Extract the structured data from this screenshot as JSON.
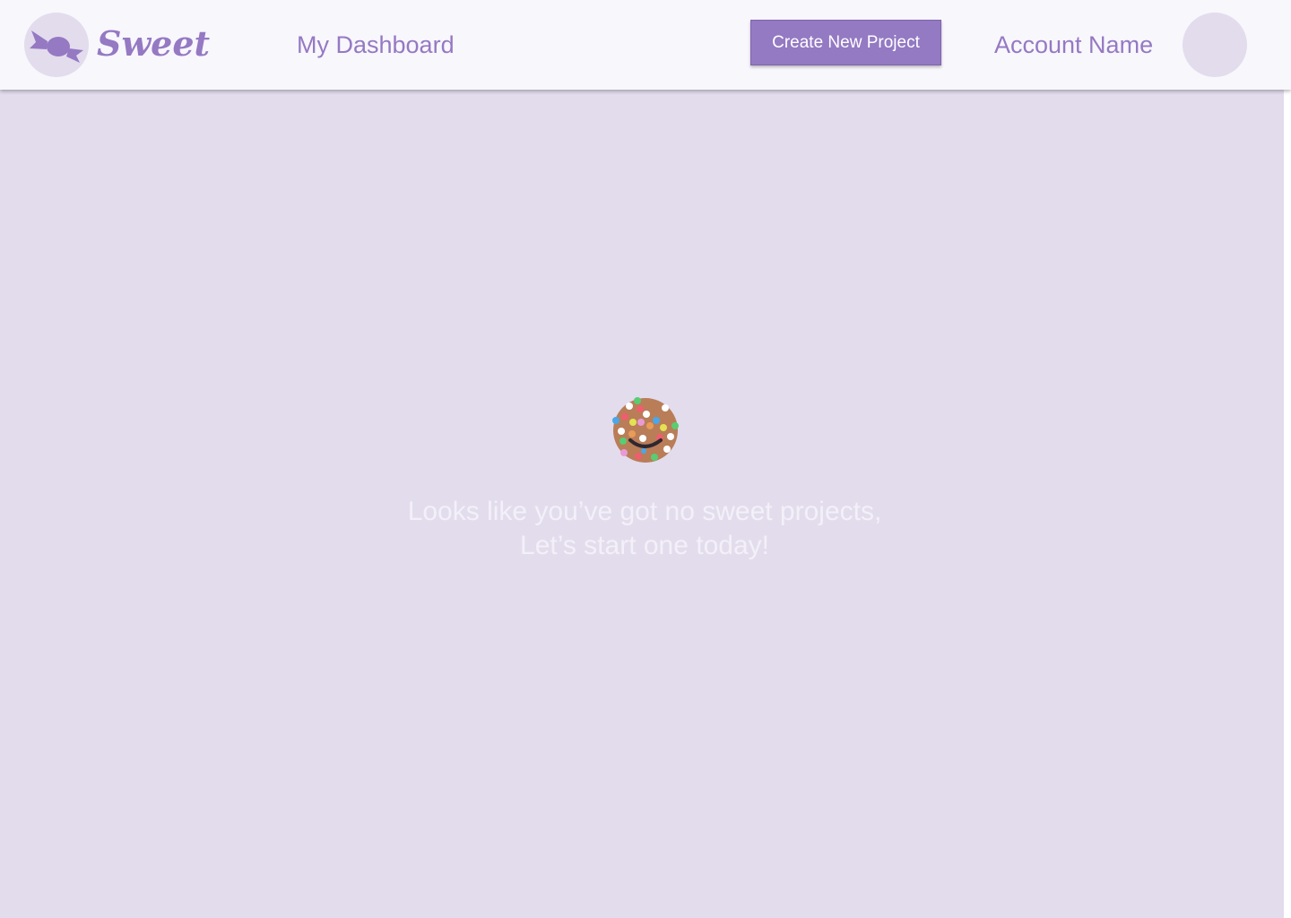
{
  "header": {
    "brand": "Sweet",
    "logo_icon": "candy-icon",
    "nav_link": "My Dashboard",
    "create_button_label": "Create New Project",
    "account_name": "Account Name",
    "avatar_icon": "avatar-placeholder"
  },
  "empty_state": {
    "icon": "sprinkle-cookie-icon",
    "line1": "Looks like you’ve got no sweet projects,",
    "line2": "Let’s start one today!"
  },
  "colors": {
    "accent": "#9579c3",
    "background": "#e3dced",
    "header_background": "#f8f7fc",
    "button_background": "#9479c3"
  }
}
